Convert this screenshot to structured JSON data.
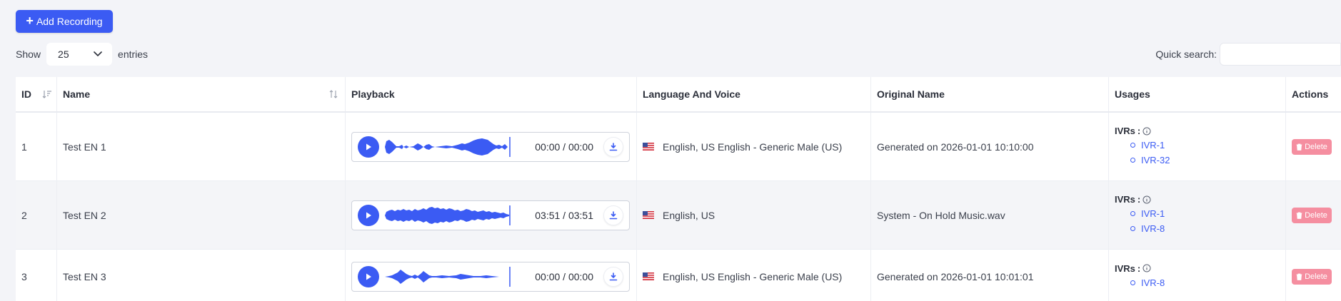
{
  "toolbar": {
    "add_label": "Add Recording",
    "show_label": "Show",
    "entries_value": "25",
    "entries_label": "entries",
    "quick_search_label": "Quick search:",
    "quick_search_value": ""
  },
  "table": {
    "headers": {
      "id": "ID",
      "name": "Name",
      "playback": "Playback",
      "language": "Language And Voice",
      "original": "Original Name",
      "usages": "Usages",
      "actions": "Actions"
    },
    "rows": [
      {
        "id": "1",
        "name": "Test EN 1",
        "time": "00:00 / 00:00",
        "language": "English, US English - Generic Male (US)",
        "original": "Generated on 2026-01-01 10:10:00",
        "usage_title": "IVRs",
        "usages": [
          "IVR-1",
          "IVR-32"
        ],
        "delete_label": "Delete"
      },
      {
        "id": "2",
        "name": "Test EN 2",
        "time": "03:51 / 03:51",
        "language": "English, US",
        "original": "System - On Hold Music.wav",
        "usage_title": "IVRs",
        "usages": [
          "IVR-1",
          "IVR-8"
        ],
        "delete_label": "Delete"
      },
      {
        "id": "3",
        "name": "Test EN 3",
        "time": "00:00 / 00:00",
        "language": "English, US English - Generic Male (US)",
        "original": "Generated on 2026-01-01 10:01:01",
        "usage_title": "IVRs",
        "usages": [
          "IVR-8"
        ],
        "delete_label": "Delete"
      }
    ]
  },
  "colors": {
    "accent": "#3b5bf3",
    "delete": "#f58ea0",
    "background": "#f3f4f8"
  },
  "icons": {
    "add": "plus-icon",
    "select": "chevron-down-icon",
    "sort_id": "sort-descending-icon",
    "sort_name": "sort-icon",
    "play": "play-icon",
    "download": "download-icon",
    "flag": "us-flag-icon",
    "info": "info-icon",
    "delete": "trash-icon"
  }
}
